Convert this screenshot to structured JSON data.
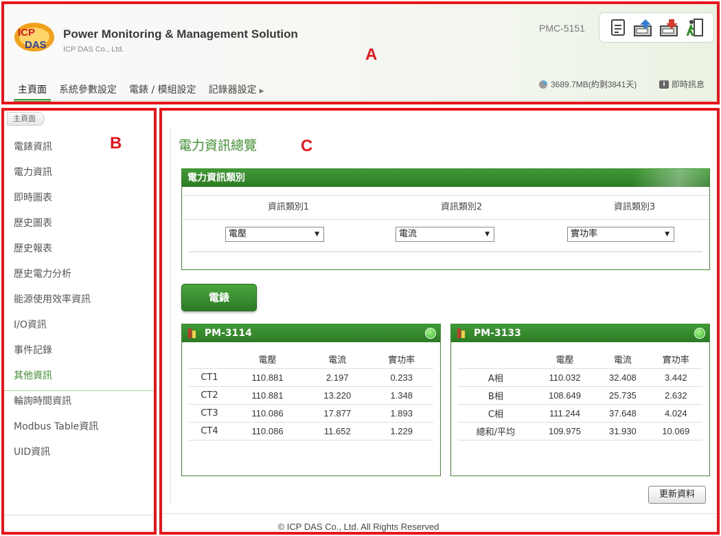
{
  "colors": {
    "accent": "#3f8f30",
    "annotation": "#e8151b",
    "status_ok": "#39b82a"
  },
  "header": {
    "title": "Power Monitoring & Management Solution",
    "company": "ICP DAS Co., Ltd.",
    "model": "PMC-5151",
    "storage": "3689.7MB(約剩3841天)",
    "messages_label": "即時訊息",
    "toolbar_icons": [
      "document-icon",
      "upload-icon",
      "download-icon",
      "exit-icon"
    ],
    "annotation_label": "A"
  },
  "nav": {
    "items": [
      {
        "label": "主頁面",
        "active": true
      },
      {
        "label": "系統參數設定"
      },
      {
        "label": "電錶 / 模組設定"
      },
      {
        "label": "記錄器設定"
      }
    ]
  },
  "sidebar": {
    "breadcrumb": "主頁面",
    "annotation_label": "B",
    "items": [
      {
        "label": "電錶資訊"
      },
      {
        "label": "電力資訊"
      },
      {
        "label": "即時圖表"
      },
      {
        "label": "歷史圖表"
      },
      {
        "label": "歷史報表"
      },
      {
        "label": "歷史電力分析"
      },
      {
        "label": "能源使用效率資訊"
      },
      {
        "label": "I/O資訊"
      },
      {
        "label": "事件記錄"
      },
      {
        "label": "其他資訊",
        "active": true
      },
      {
        "label": "輪詢時間資訊"
      },
      {
        "label": "Modbus Table資訊"
      },
      {
        "label": "UID資訊"
      }
    ]
  },
  "main": {
    "title": "電力資訊總覽",
    "annotation_label": "C",
    "category_panel": {
      "title": "電力資訊類別",
      "headers": [
        "資訊類別1",
        "資訊類別2",
        "資訊類別3"
      ],
      "selected": [
        "電壓",
        "電流",
        "實功率"
      ]
    },
    "meter_button": "電錶",
    "meters": [
      {
        "name": "PM-3114",
        "columns": [
          "電壓",
          "電流",
          "實功率"
        ],
        "rows": [
          {
            "label": "CT1",
            "values": [
              "110.881",
              "2.197",
              "0.233"
            ]
          },
          {
            "label": "CT2",
            "values": [
              "110.881",
              "13.220",
              "1.348"
            ]
          },
          {
            "label": "CT3",
            "values": [
              "110.086",
              "17.877",
              "1.893"
            ]
          },
          {
            "label": "CT4",
            "values": [
              "110.086",
              "11.652",
              "1.229"
            ]
          }
        ]
      },
      {
        "name": "PM-3133",
        "columns": [
          "電壓",
          "電流",
          "實功率"
        ],
        "rows": [
          {
            "label": "A相",
            "values": [
              "110.032",
              "32.408",
              "3.442"
            ]
          },
          {
            "label": "B相",
            "values": [
              "108.649",
              "25.735",
              "2.632"
            ]
          },
          {
            "label": "C相",
            "values": [
              "111.244",
              "37.648",
              "4.024"
            ]
          },
          {
            "label": "總和/平均",
            "values": [
              "109.975",
              "31.930",
              "10.069"
            ]
          }
        ]
      }
    ],
    "refresh_button": "更新資料",
    "copyright": "© ICP DAS Co., Ltd. All Rights Reserved"
  }
}
